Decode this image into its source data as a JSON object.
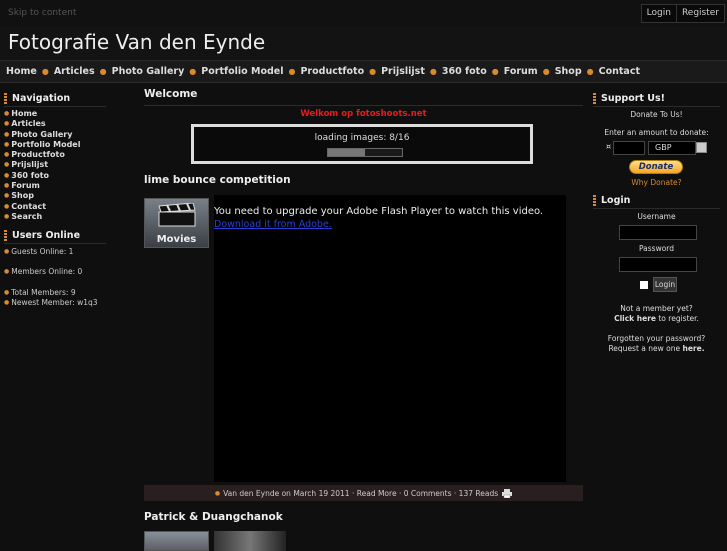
{
  "topbar": {
    "skip": "Skip to content",
    "login": "Login",
    "register": "Register"
  },
  "site": {
    "title": "Fotografie Van den Eynde"
  },
  "nav": [
    "Home",
    "Articles",
    "Photo Gallery",
    "Portfolio Model",
    "Productfoto",
    "Prijslijst",
    "360 foto",
    "Forum",
    "Shop",
    "Contact"
  ],
  "left": {
    "nav_title": "Navigation",
    "links": [
      "Home",
      "Articles",
      "Photo Gallery",
      "Portfolio Model",
      "Productfoto",
      "Prijslijst",
      "360 foto",
      "Forum",
      "Shop",
      "Contact",
      "Search"
    ],
    "users_title": "Users Online",
    "guests": "Guests Online: 1",
    "members": "Members Online: 0",
    "total": "Total Members: 9",
    "newest": "Newest Member: w1q3"
  },
  "main": {
    "welcome_title": "Welcome",
    "welcome_msg": "Welkom op fotoshoots.net",
    "loader_text": "loading images: 8/16",
    "loader_progress": 0.5,
    "article1_title": "lime bounce competition",
    "movies_label": "Movies",
    "flash_msg": "You need to upgrade your Adobe Flash Player to watch this video.",
    "flash_link": "Download it from Adobe.",
    "meta": "Van den Eynde on March 19 2011 · Read More · 0 Comments · 137 Reads",
    "article2_title": "Patrick & Duangchanok"
  },
  "right": {
    "support_title": "Support Us!",
    "donate_to_us": "Donate To Us!",
    "enter_amount": "Enter an amount to donate:",
    "currency_symbol": "¤",
    "currency": "GBP",
    "donate_btn": "Donate",
    "why": "Why Donate?",
    "login_title": "Login",
    "username": "Username",
    "password": "Password",
    "login_btn": "Login",
    "not_member": "Not a member yet?",
    "click_here": "Click here",
    "to_register": " to register.",
    "forgot": "Forgotten your password?",
    "request": "Request a new one ",
    "here": "here."
  },
  "colors": {
    "accent": "#d98a2c",
    "welcome_red": "#e41c1c",
    "link_blue": "#2a3fd0"
  }
}
